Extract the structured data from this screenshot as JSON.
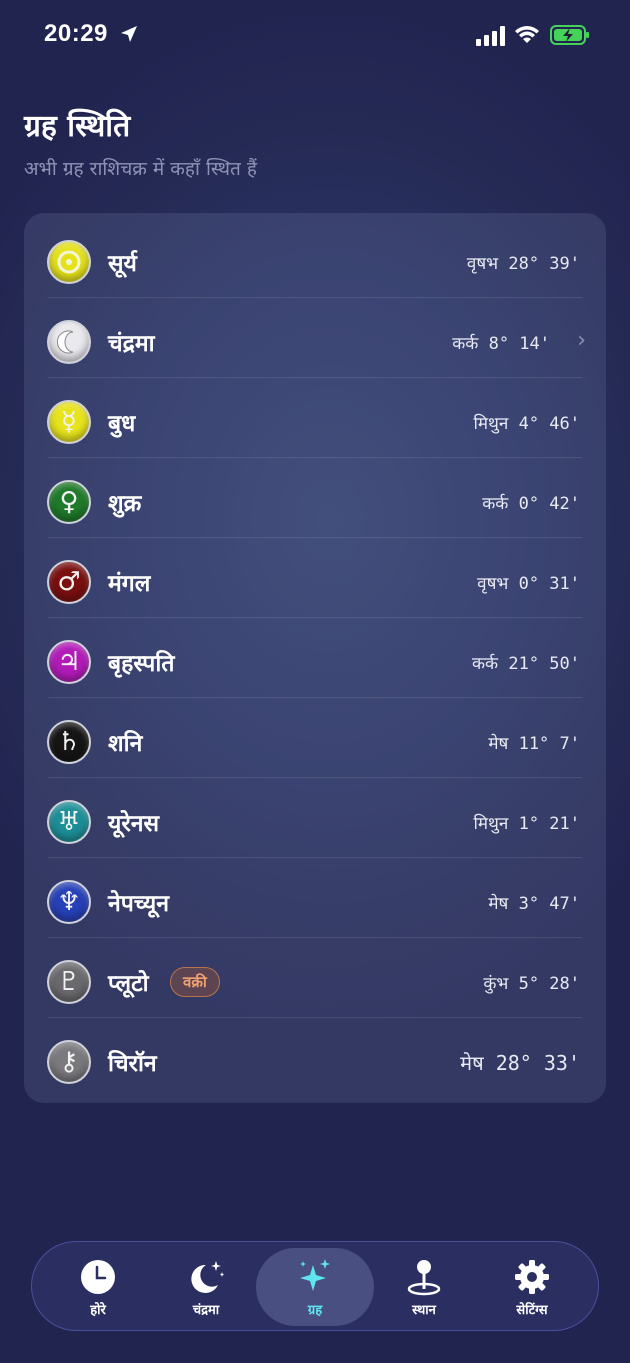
{
  "status": {
    "time": "20:29"
  },
  "header": {
    "title": "ग्रह स्थिति",
    "subtitle": "अभी ग्रह राशिचक्र में कहाँ स्थित हैं"
  },
  "planets": [
    {
      "name": "सूर्य",
      "position": "वृषभ 28° 39'",
      "icon": "sun-icon",
      "color": "#e6e21a"
    },
    {
      "name": "चंद्रमा",
      "position": "कर्क 8° 14'",
      "icon": "moon-icon",
      "color": "#e9e9ee",
      "has_chevron": true
    },
    {
      "name": "बुध",
      "position": "मिथुन 4° 46'",
      "icon": "mercury-icon",
      "color": "#e8e41c"
    },
    {
      "name": "शुक्र",
      "position": "कर्क 0° 42'",
      "icon": "venus-icon",
      "color": "#1f7a2a"
    },
    {
      "name": "मंगल",
      "position": "वृषभ 0° 31'",
      "icon": "mars-icon",
      "color": "#7a0f10"
    },
    {
      "name": "बृहस्पति",
      "position": "कर्क 21° 50'",
      "icon": "jupiter-icon",
      "color": "#b21bb8"
    },
    {
      "name": "शनि",
      "position": "मेष 11° 7'",
      "icon": "saturn-icon",
      "color": "#151515"
    },
    {
      "name": "यूरेनस",
      "position": "मिथुन 1° 21'",
      "icon": "uranus-icon",
      "color": "#1c8f98"
    },
    {
      "name": "नेपच्यून",
      "position": "मेष 3° 47'",
      "icon": "neptune-icon",
      "color": "#2740b8"
    },
    {
      "name": "प्लूटो",
      "position": "कुंभ 5° 28'",
      "icon": "pluto-icon",
      "color": "#6a6a6e",
      "badge": "वक्री"
    },
    {
      "name": "चिरॉन",
      "position": "मेष 28° 33'",
      "icon": "chiron-icon",
      "color": "#7a7a7e"
    }
  ],
  "tabs": [
    {
      "label": "होरे",
      "icon": "clock-icon"
    },
    {
      "label": "चंद्रमा",
      "icon": "moon-stars-icon"
    },
    {
      "label": "ग्रह",
      "icon": "sparkles-icon",
      "active": true
    },
    {
      "label": "स्थान",
      "icon": "location-pin-icon"
    },
    {
      "label": "सेटिंग्स",
      "icon": "gear-icon"
    }
  ],
  "accent_color": "#5ee5f0"
}
